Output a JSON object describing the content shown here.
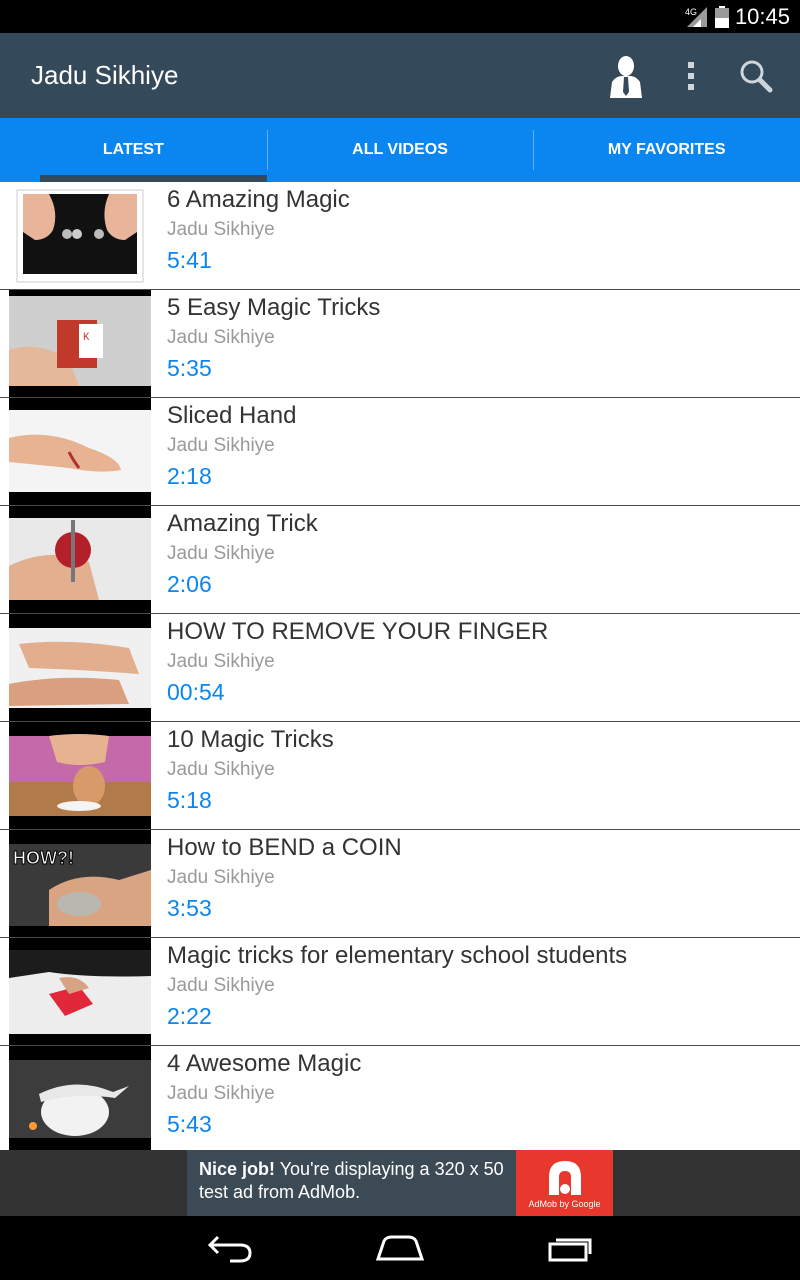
{
  "status_bar": {
    "network": "4G",
    "time": "10:45"
  },
  "app_bar": {
    "title": "Jadu Sikhiye"
  },
  "tabs": [
    {
      "label": "LATEST",
      "selected": true
    },
    {
      "label": "ALL VIDEOS",
      "selected": false
    },
    {
      "label": "MY FAVORITES",
      "selected": false
    }
  ],
  "videos": [
    {
      "title": "6 Amazing Magic",
      "channel": "Jadu Sikhiye",
      "duration": "5:41"
    },
    {
      "title": "5 Easy Magic Tricks",
      "channel": "Jadu Sikhiye",
      "duration": "5:35"
    },
    {
      "title": "Sliced Hand",
      "channel": "Jadu Sikhiye",
      "duration": "2:18"
    },
    {
      "title": "Amazing Trick",
      "channel": "Jadu Sikhiye",
      "duration": "2:06"
    },
    {
      "title": "HOW TO REMOVE YOUR FINGER",
      "channel": "Jadu Sikhiye",
      "duration": "00:54"
    },
    {
      "title": "10 Magic Tricks",
      "channel": "Jadu Sikhiye",
      "duration": "5:18"
    },
    {
      "title": "How to BEND a COIN",
      "channel": "Jadu Sikhiye",
      "duration": "3:53"
    },
    {
      "title": "Magic tricks for elementary school students",
      "channel": "Jadu Sikhiye",
      "duration": "2:22"
    },
    {
      "title": "4 Awesome Magic",
      "channel": "Jadu Sikhiye",
      "duration": "5:43"
    }
  ],
  "thumb_overlay_text": "HOW?!",
  "ad": {
    "bold": "Nice job!",
    "text": " You're displaying a 320 x 50 test ad from AdMob.",
    "logo_caption": "AdMob by Google"
  },
  "colors": {
    "action_bar": "#34495a",
    "tab_bar": "#0a86f0",
    "duration": "#0a86f0",
    "ad_logo": "#e8372c"
  }
}
